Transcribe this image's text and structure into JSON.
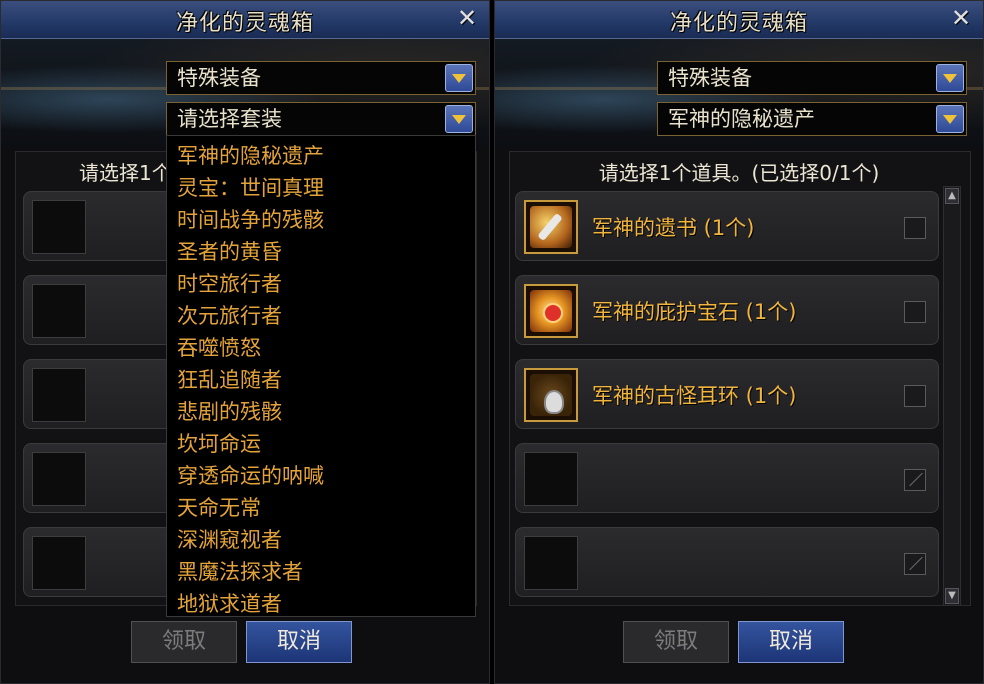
{
  "left_window": {
    "title": "净化的灵魂箱",
    "category_select": "特殊装备",
    "set_select": "请选择套装",
    "prompt": "请选择1个",
    "dropdown_options": [
      "军神的隐秘遗产",
      "灵宝：世间真理",
      "时间战争的残骸",
      "圣者的黄昏",
      "时空旅行者",
      "次元旅行者",
      "吞噬愤怒",
      "狂乱追随者",
      "悲剧的残骸",
      "坎坷命运",
      "穿透命运的呐喊",
      "天命无常",
      "深渊窥视者",
      "黑魔法探求者",
      "地狱求道者"
    ],
    "confirm_button": "领取",
    "cancel_button": "取消"
  },
  "right_window": {
    "title": "净化的灵魂箱",
    "category_select": "特殊装备",
    "set_select": "军神的隐秘遗产",
    "prompt": "请选择1个道具。(已选择0/1个)",
    "items": [
      {
        "name": "军神的遗书 (1个)",
        "icon": "letter-quill-icon"
      },
      {
        "name": "军神的庇护宝石 (1个)",
        "icon": "sun-gem-icon"
      },
      {
        "name": "军神的古怪耳环 (1个)",
        "icon": "earring-icon"
      }
    ],
    "confirm_button": "领取",
    "cancel_button": "取消"
  },
  "colors": {
    "titlebar": "#223866",
    "item_text": "#f1b43c",
    "dropdown_text": "#e4a33a",
    "button_primary": "#1d3577"
  }
}
